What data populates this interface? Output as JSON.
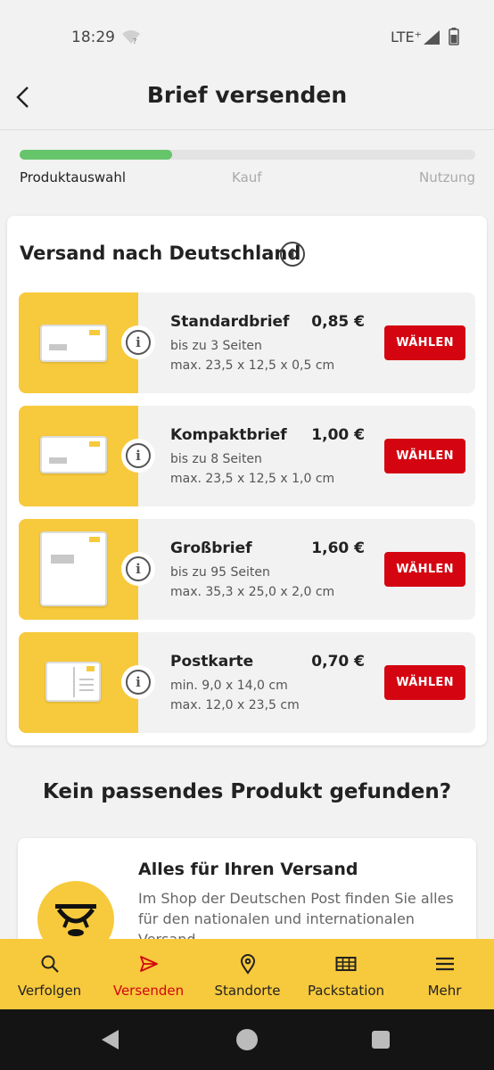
{
  "status": {
    "time": "18:29",
    "network": "LTE⁺"
  },
  "header": {
    "title": "Brief versenden"
  },
  "progress": {
    "fraction": 0.335,
    "steps": [
      "Produktauswahl",
      "Kauf",
      "Nutzung"
    ]
  },
  "section": {
    "title": "Versand nach Deutschland",
    "info_symbol": "i"
  },
  "products": [
    {
      "name": "Standardbrief",
      "price": "0,85 €",
      "line1": "bis zu 3 Seiten",
      "line2": "max. 23,5 x 12,5 x 0,5 cm",
      "button": "WÄHLEN",
      "icon": "standard-letter-icon"
    },
    {
      "name": "Kompaktbrief",
      "price": "1,00 €",
      "line1": "bis zu 8 Seiten",
      "line2": "max. 23,5 x 12,5 x 1,0 cm",
      "button": "WÄHLEN",
      "icon": "compact-letter-icon"
    },
    {
      "name": "Großbrief",
      "price": "1,60 €",
      "line1": "bis zu 95 Seiten",
      "line2": "max. 35,3 x 25,0 x 2,0 cm",
      "button": "WÄHLEN",
      "icon": "large-letter-icon"
    },
    {
      "name": "Postkarte",
      "price": "0,70 €",
      "line1": "min. 9,0 x 14,0 cm",
      "line2": "max. 12,0 x 23,5 cm",
      "button": "WÄHLEN",
      "icon": "postcard-icon"
    }
  ],
  "no_product": {
    "title": "Kein passendes Produkt gefunden?"
  },
  "shop": {
    "title": "Alles für Ihren Versand",
    "text": "Im Shop der Deutschen Post finden Sie alles für den nationalen und internationalen Versand."
  },
  "nav": [
    {
      "label": "Verfolgen",
      "icon": "search-icon",
      "active": false
    },
    {
      "label": "Versenden",
      "icon": "send-icon",
      "active": true
    },
    {
      "label": "Standorte",
      "icon": "location-pin-icon",
      "active": false
    },
    {
      "label": "Packstation",
      "icon": "packstation-icon",
      "active": false
    },
    {
      "label": "Mehr",
      "icon": "menu-icon",
      "active": false
    }
  ],
  "colors": {
    "brand_yellow": "#f7c93c",
    "brand_red": "#d40511",
    "progress_green": "#66c46a"
  }
}
